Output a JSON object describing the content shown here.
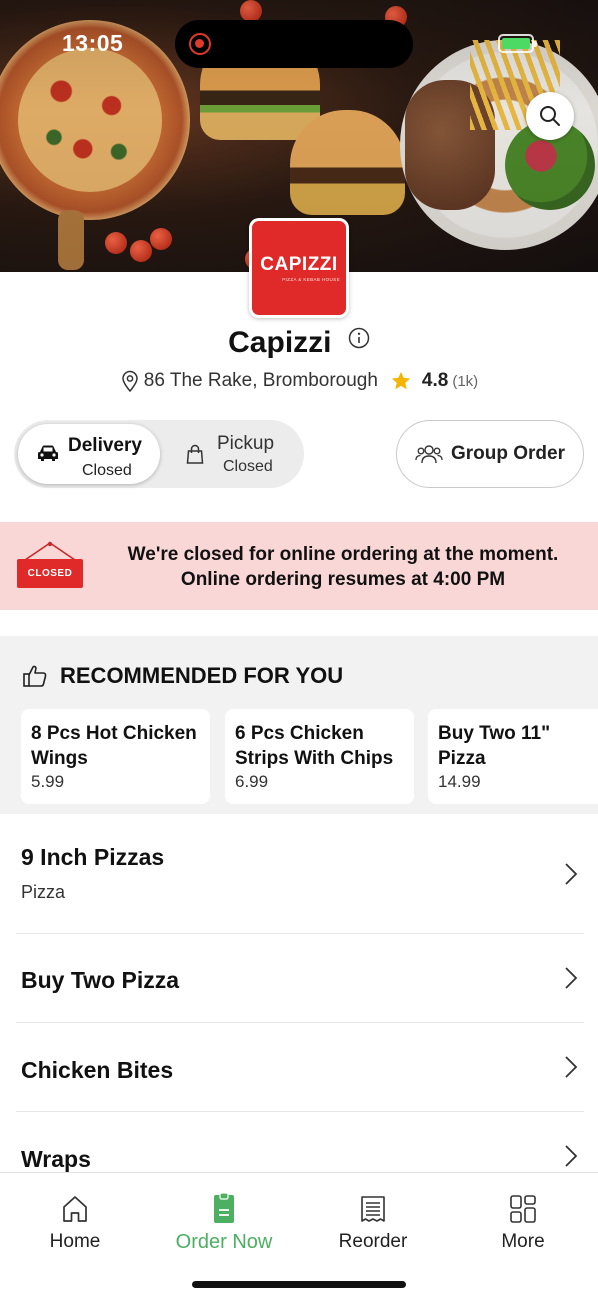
{
  "status_bar": {
    "time": "13:05"
  },
  "store": {
    "logo_text": "CAPIZZI",
    "logo_tagline": "PIZZA & KEBAB HOUSE",
    "name": "Capizzi",
    "address": "86 The Rake, Bromborough",
    "rating": "4.8",
    "rating_count": "(1k)"
  },
  "order_mode": {
    "delivery": {
      "label": "Delivery",
      "status": "Closed"
    },
    "pickup": {
      "label": "Pickup",
      "status": "Closed"
    },
    "selected": "delivery"
  },
  "group_order_label": "Group Order",
  "closed_banner": {
    "sign_text": "CLOSED",
    "line1": "We're closed for online ordering at the moment.",
    "line2": "Online ordering resumes at 4:00 PM"
  },
  "recommended": {
    "title": "RECOMMENDED FOR YOU",
    "items": [
      {
        "name": "8 Pcs Hot Chicken Wings",
        "price": "5.99"
      },
      {
        "name": "6 Pcs Chicken Strips With Chips",
        "price": "6.99"
      },
      {
        "name": "Buy Two 11\" Pizza",
        "price": "14.99"
      }
    ]
  },
  "categories": [
    {
      "name": "9 Inch Pizzas",
      "subtitle": "Pizza"
    },
    {
      "name": "Buy Two Pizza",
      "subtitle": ""
    },
    {
      "name": "Chicken Bites",
      "subtitle": ""
    },
    {
      "name": "Wraps",
      "subtitle": ""
    }
  ],
  "tabs": [
    {
      "label": "Home",
      "icon": "home-icon"
    },
    {
      "label": "Order Now",
      "icon": "order-icon"
    },
    {
      "label": "Reorder",
      "icon": "receipt-icon"
    },
    {
      "label": "More",
      "icon": "grid-icon"
    }
  ],
  "colors": {
    "accent_green": "#4caf62",
    "brand_red": "#e02a2a",
    "banner_pink": "#fad7d7",
    "star": "#f5b400"
  }
}
